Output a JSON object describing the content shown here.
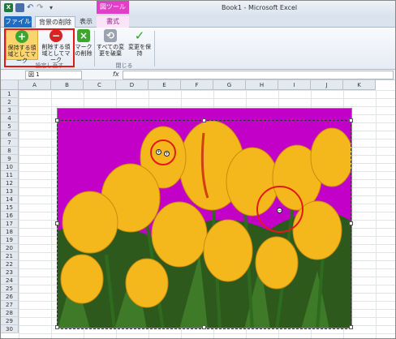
{
  "window": {
    "title": "Book1 - Microsoft Excel",
    "context_tool": "図ツール",
    "logo": "X"
  },
  "tabs": {
    "file": "ファイル",
    "background_removal": "背景の削除",
    "view": "表示",
    "format": "書式"
  },
  "ribbon": {
    "keep": "保持する領域としてマーク",
    "remove": "削除する領域としてマーク",
    "delete_mark": "マークの削除",
    "discard": "すべての変更を破棄",
    "keep_changes": "変更を保持",
    "group_refine": "設定し直す",
    "group_close": "閉じる"
  },
  "formula_bar": {
    "name_box": "図 1",
    "fx": "fx"
  },
  "columns": [
    "A",
    "B",
    "C",
    "D",
    "E",
    "F",
    "G",
    "H",
    "I",
    "J",
    "K"
  ],
  "rows": [
    "1",
    "2",
    "3",
    "4",
    "5",
    "6",
    "7",
    "8",
    "9",
    "10",
    "11",
    "12",
    "13",
    "14",
    "15",
    "16",
    "17",
    "18",
    "19",
    "20",
    "21",
    "22",
    "23",
    "24",
    "25",
    "26",
    "27",
    "28",
    "29",
    "30"
  ],
  "colors": {
    "removed_background": "#c300c8",
    "tulip_yellow": "#f5b81c",
    "highlight_red": "#e41818"
  },
  "marks": {
    "keep_symbol": "+",
    "remove_symbol": "−"
  }
}
